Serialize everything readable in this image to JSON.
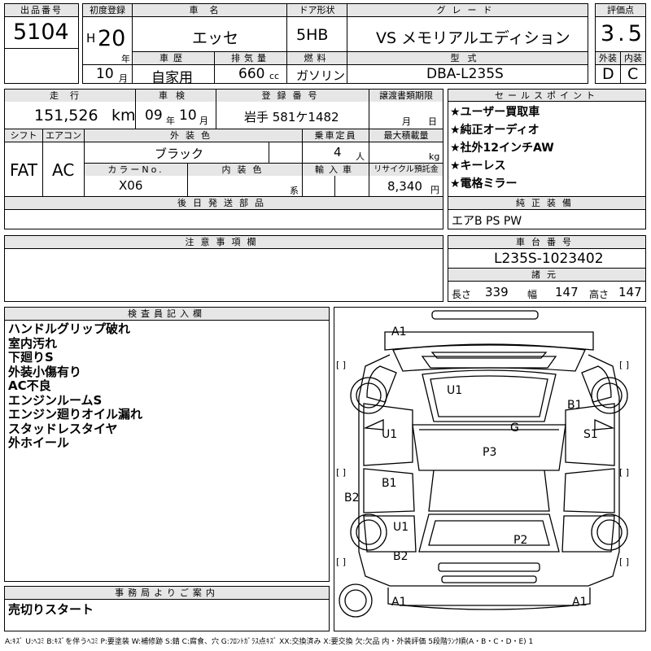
{
  "header": {
    "lot_label": "出品番号",
    "lot_no": "5104",
    "first_reg_label": "初度登録",
    "era": "H",
    "year": "20",
    "year_unit": "年",
    "month": "10",
    "month_unit": "月",
    "car_name_label": "車名",
    "car_name": "エッセ",
    "door_label": "ドア形状",
    "door": "5HB",
    "grade_label": "グレード",
    "grade": "VS メモリアルエディション",
    "score_label": "評価点",
    "score": "3.5",
    "history_label": "車歴",
    "history": "自家用",
    "disp_label": "排気量",
    "disp": "660",
    "disp_unit": "cc",
    "fuel_label": "燃料",
    "fuel": "ガソリン",
    "model_label": "型式",
    "model": "DBA-L235S",
    "ext_label": "外装",
    "ext": "D",
    "int_label": "内装",
    "int": "C"
  },
  "row2": {
    "mileage_label": "走行",
    "mileage": "151,526",
    "mileage_unit": "km",
    "inspect_label": "車検",
    "inspect_year": "09",
    "inspect_year_unit": "年",
    "inspect_month": "10",
    "inspect_month_unit": "月",
    "plate_label": "登録番号",
    "plate": "岩手 581ケ1482",
    "transfer_label": "譲渡書類期限",
    "transfer_month_unit": "月",
    "transfer_day_unit": "日",
    "shift_label": "シフト",
    "shift": "FAT",
    "ac_label": "エアコン",
    "ac": "AC",
    "color_label": "外装色",
    "color": "ブラック",
    "capacity_label": "乗車定員",
    "capacity": "4",
    "capacity_unit": "人",
    "load_label": "最大積載量",
    "load_unit": "kg",
    "colorno_label": "カラーNo.",
    "colorno": "X06",
    "intcolor_label": "内装色",
    "intcolor_unit": "系",
    "import_label": "輸入車",
    "recycle_label": "リサイクル預託金",
    "recycle": "8,340",
    "recycle_unit": "円",
    "parts_label": "後日発送部品"
  },
  "sales": {
    "label": "セールスポイント",
    "points": [
      "★ユーザー買取車",
      "★純正オーディオ",
      "★社外12インチAW",
      "★キーレス",
      "★電格ミラー"
    ]
  },
  "equip": {
    "label": "純正装備",
    "value": "エアB PS PW"
  },
  "caution": {
    "label": "注意事項欄"
  },
  "chassis": {
    "label": "車台番号",
    "value": "L235S-1023402"
  },
  "dims": {
    "label": "諸元",
    "len_label": "長さ",
    "len": "339",
    "wid_label": "幅",
    "wid": "147",
    "hgt_label": "高さ",
    "hgt": "147"
  },
  "inspector": {
    "label": "検査員記入欄",
    "remarks": [
      "ハンドルグリップ破れ",
      "室内汚れ",
      "下廻りS",
      "外装小傷有り",
      "AC不良",
      "エンジンルームS",
      "エンジン廻りオイル漏れ",
      "スタッドレスタイヤ",
      "外ホイール"
    ]
  },
  "office": {
    "label": "事務局よりご案内",
    "value": "売切りスタート"
  },
  "diagram": {
    "labels": {
      "a1_top": "A1",
      "u1_roof": "U1",
      "b1_right": "B1",
      "g": "G",
      "u1_left": "U1",
      "s1_right": "S1",
      "p3": "P3",
      "b1_left": "B1",
      "b2_left": "B2",
      "u1_rear": "U1",
      "p2": "P2",
      "b2_rear": "B2",
      "a1_bl": "A1",
      "a1_br": "A1"
    },
    "brackets": "[ ]"
  },
  "footer": "A:ｷｽﾞ U:ﾍｺﾐ B:ｷｽﾞを伴うﾍｺﾐ P:要塗装 W:補修跡 S:錆 C:腐食、穴 G:ﾌﾛﾝﾄｶﾞﾗｽ点ｷｽﾞ XX:交換済み X:要交換 欠:欠品 内・外装評価 5段階ﾗﾝｸ順(A・B・C・D・E) 1"
}
